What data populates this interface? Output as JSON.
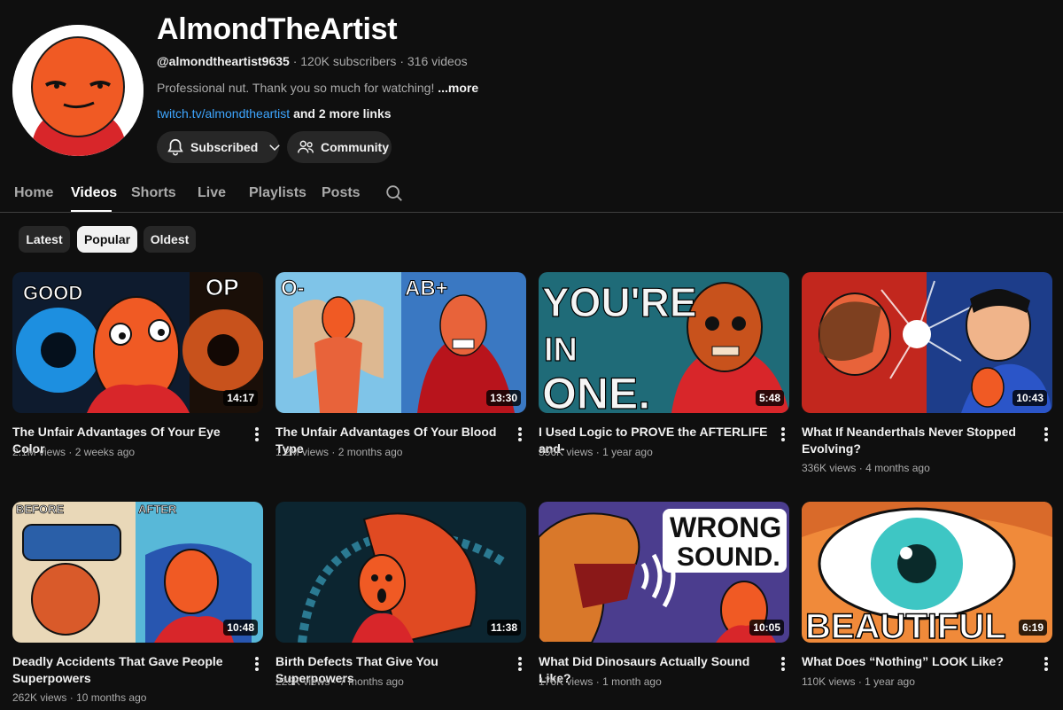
{
  "channel": {
    "name": "AlmondTheArtist",
    "handle": "@almondtheartist9635",
    "subscribers": "120K subscribers",
    "videos_count": "316 videos",
    "separator": "·",
    "description": "Professional nut. Thank you so much for watching!",
    "more_label": "...more",
    "link": "twitch.tv/almondtheartist",
    "more_links": "and 2 more links",
    "subscribed_label": "Subscribed",
    "community_label": "Community"
  },
  "tabs": [
    "Home",
    "Videos",
    "Shorts",
    "Live",
    "Playlists",
    "Posts"
  ],
  "active_tab": "Videos",
  "chips": [
    "Latest",
    "Popular",
    "Oldest"
  ],
  "active_chip": "Popular",
  "videos": [
    {
      "title": "The Unfair Advantages Of Your Eye Color",
      "views": "2.1M views",
      "age": "2 weeks ago",
      "duration": "14:17",
      "thumb_text": [
        "GOOD",
        "OP"
      ]
    },
    {
      "title": "The Unfair Advantages Of Your Blood Type",
      "views": "1.2M views",
      "age": "2 months ago",
      "duration": "13:30",
      "thumb_text": [
        "O-",
        "AB+"
      ]
    },
    {
      "title": "I Used Logic to PROVE the AFTERLIFE and-",
      "views": "356K views",
      "age": "1 year ago",
      "duration": "5:48",
      "thumb_text": [
        "YOU'RE",
        "IN",
        "ONE."
      ]
    },
    {
      "title": "What If Neanderthals Never Stopped Evolving?",
      "views": "336K views",
      "age": "4 months ago",
      "duration": "10:43",
      "thumb_text": []
    },
    {
      "title": "Deadly Accidents That Gave People Superpowers",
      "views": "262K views",
      "age": "10 months ago",
      "duration": "10:48",
      "thumb_text": [
        "BEFORE",
        "AFTER"
      ]
    },
    {
      "title": "Birth Defects That Give You Superpowers",
      "views": "225K views",
      "age": "7 months ago",
      "duration": "11:38",
      "thumb_text": []
    },
    {
      "title": "What Did Dinosaurs Actually Sound Like?",
      "views": "176K views",
      "age": "1 month ago",
      "duration": "10:05",
      "thumb_text": [
        "WRONG",
        "SOUND."
      ]
    },
    {
      "title": "What Does “Nothing” LOOK Like?",
      "views": "110K views",
      "age": "1 year ago",
      "duration": "6:19",
      "thumb_text": [
        "BEAUTIFUL"
      ]
    }
  ],
  "colors": {
    "background": "#0f0f0f",
    "chip": "#272727",
    "link": "#3ea6ff",
    "almond_orange": "#f05a24"
  }
}
